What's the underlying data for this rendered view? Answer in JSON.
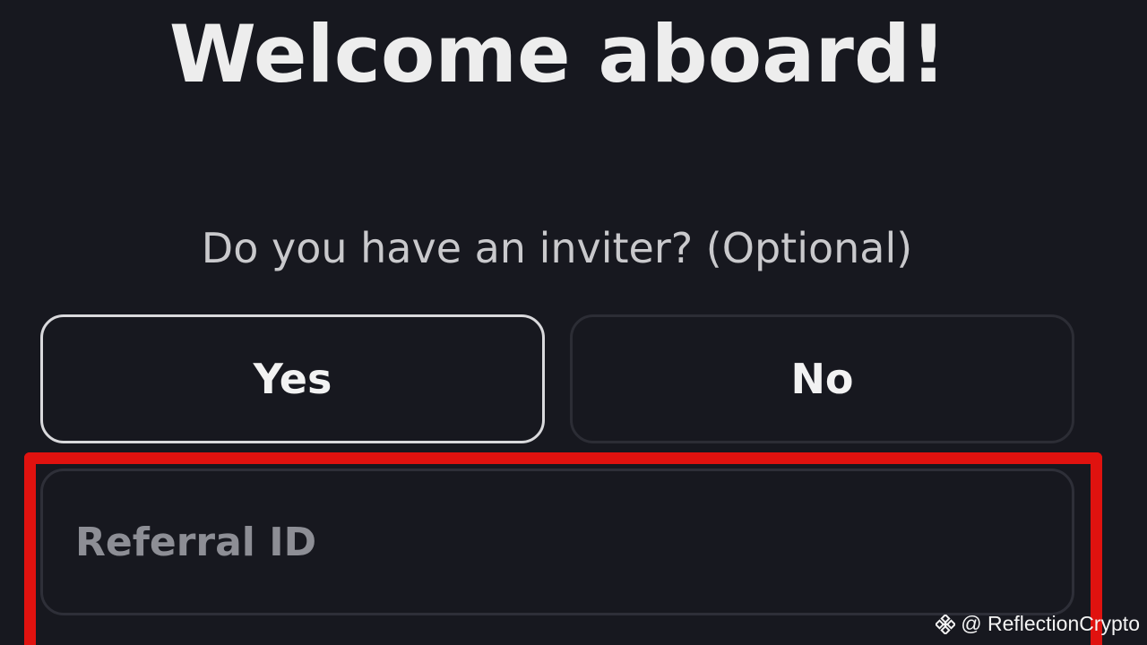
{
  "screen": {
    "title": "Welcome aboard!",
    "question": "Do you have an inviter? (Optional)"
  },
  "choices": {
    "yes_label": "Yes",
    "no_label": "No",
    "selected": "Yes"
  },
  "referral": {
    "placeholder": "Referral ID",
    "value": ""
  },
  "watermark": {
    "logo_icon": "binance-logo-icon",
    "text": "@ ReflectionCrypto"
  },
  "colors": {
    "background": "#17181f",
    "highlight": "#e0120f",
    "selected_border": "#d9d9dc"
  }
}
